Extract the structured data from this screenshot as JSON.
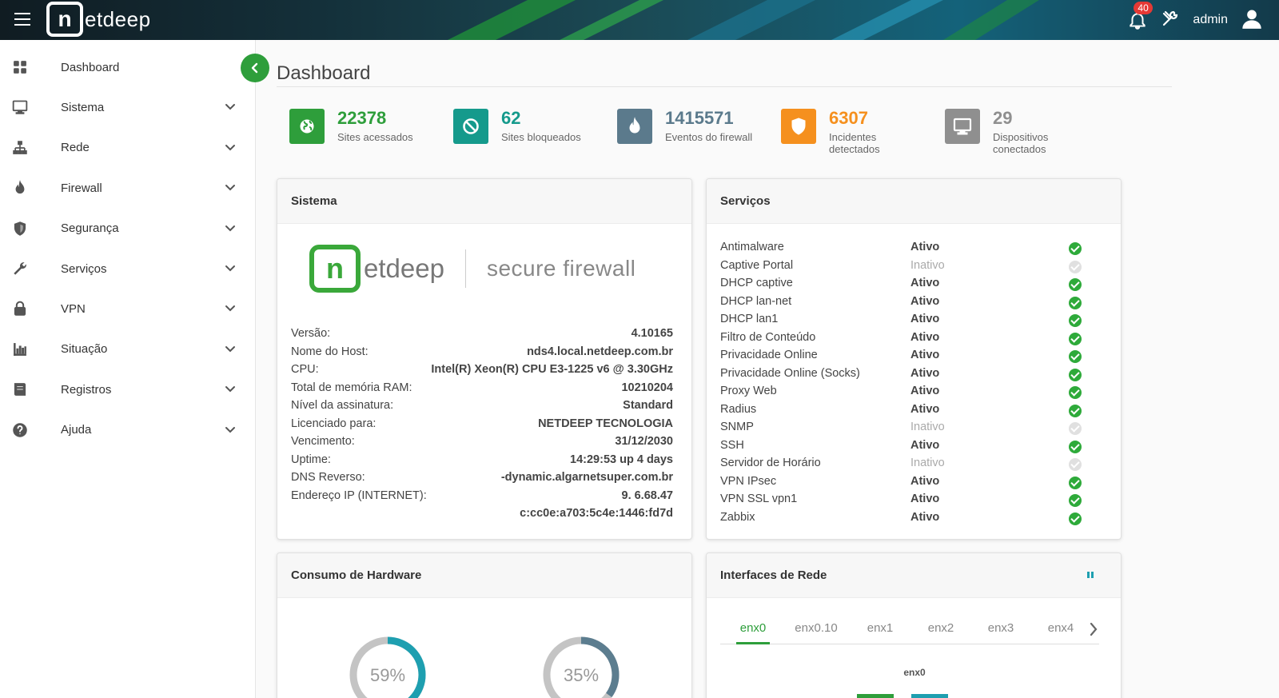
{
  "topbar": {
    "brand_n": "n",
    "brand_rest": "etdeep",
    "notifications": "40",
    "user": "admin"
  },
  "sidebar": {
    "items": [
      {
        "label": "Dashboard",
        "icon": "dashboard-icon",
        "expandable": false
      },
      {
        "label": "Sistema",
        "icon": "monitor-icon",
        "expandable": true
      },
      {
        "label": "Rede",
        "icon": "network-icon",
        "expandable": true
      },
      {
        "label": "Firewall",
        "icon": "fire-icon",
        "expandable": true
      },
      {
        "label": "Segurança",
        "icon": "shield-icon",
        "expandable": true
      },
      {
        "label": "Serviços",
        "icon": "wrench-icon",
        "expandable": true
      },
      {
        "label": "VPN",
        "icon": "lock-icon",
        "expandable": true
      },
      {
        "label": "Situação",
        "icon": "bar-chart-icon",
        "expandable": true
      },
      {
        "label": "Registros",
        "icon": "book-icon",
        "expandable": true
      },
      {
        "label": "Ajuda",
        "icon": "help-icon",
        "expandable": true
      }
    ]
  },
  "page": {
    "title": "Dashboard"
  },
  "stats": [
    {
      "value": "22378",
      "label": "Sites acessados",
      "color": "#2e9e3b",
      "icon": "globe-icon"
    },
    {
      "value": "62",
      "label": "Sites bloqueados",
      "color": "#159a8c",
      "icon": "block-icon"
    },
    {
      "value": "1415571",
      "label": "Eventos do firewall",
      "color": "#5b7a8c",
      "icon": "fire-icon"
    },
    {
      "value": "6307",
      "label": "Incidentes detectados",
      "color": "#f5901e",
      "icon": "shield-icon"
    },
    {
      "value": "29",
      "label": "Dispositivos conectados",
      "color": "#8f8f8f",
      "icon": "monitor-icon"
    }
  ],
  "sistema": {
    "title": "Sistema",
    "logo_n": "n",
    "logo_rest": "etdeep",
    "tagline": "secure firewall",
    "rows": [
      {
        "k": "Versão:",
        "v": "4.10165"
      },
      {
        "k": "Nome do Host:",
        "v": "nds4.local.netdeep.com.br"
      },
      {
        "k": "CPU:",
        "v": "Intel(R) Xeon(R) CPU E3-1225 v6 @ 3.30GHz"
      },
      {
        "k": "Total de memória RAM:",
        "v": "10210204"
      },
      {
        "k": "Nível da assinatura:",
        "v": "Standard"
      },
      {
        "k": "Licenciado para:",
        "v": "NETDEEP TECNOLOGIA"
      },
      {
        "k": "Vencimento:",
        "v": "31/12/2030"
      },
      {
        "k": "Uptime:",
        "v": "14:29:53 up 4 days"
      },
      {
        "k": "DNS Reverso:",
        "v": "-dynamic.algarnetsuper.com.br"
      },
      {
        "k": "Endereço IP (INTERNET):",
        "v": "9.    6.68.47"
      },
      {
        "k": "",
        "v": "c:cc0e:a703:5c4e:1446:fd7d"
      }
    ]
  },
  "servicos": {
    "title": "Serviços",
    "rows": [
      {
        "name": "Antimalware",
        "status": "Ativo",
        "active": true
      },
      {
        "name": "Captive Portal",
        "status": "Inativo",
        "active": false
      },
      {
        "name": "DHCP captive",
        "status": "Ativo",
        "active": true
      },
      {
        "name": "DHCP lan-net",
        "status": "Ativo",
        "active": true
      },
      {
        "name": "DHCP lan1",
        "status": "Ativo",
        "active": true
      },
      {
        "name": "Filtro de Conteúdo",
        "status": "Ativo",
        "active": true
      },
      {
        "name": "Privacidade Online",
        "status": "Ativo",
        "active": true
      },
      {
        "name": "Privacidade Online (Socks)",
        "status": "Ativo",
        "active": true
      },
      {
        "name": "Proxy Web",
        "status": "Ativo",
        "active": true
      },
      {
        "name": "Radius",
        "status": "Ativo",
        "active": true
      },
      {
        "name": "SNMP",
        "status": "Inativo",
        "active": false
      },
      {
        "name": "SSH",
        "status": "Ativo",
        "active": true
      },
      {
        "name": "Servidor de Horário",
        "status": "Inativo",
        "active": false
      },
      {
        "name": "VPN IPsec",
        "status": "Ativo",
        "active": true
      },
      {
        "name": "VPN SSL vpn1",
        "status": "Ativo",
        "active": true
      },
      {
        "name": "Zabbix",
        "status": "Ativo",
        "active": true
      }
    ]
  },
  "hardware": {
    "title": "Consumo de Hardware",
    "gauges": [
      {
        "value": 59,
        "label": "59%",
        "color": "#1e9fb0"
      },
      {
        "value": 35,
        "label": "35%",
        "color": "#5c7d8f"
      }
    ]
  },
  "interfaces": {
    "title": "Interfaces de Rede",
    "tabs": [
      "enx0",
      "enx0.10",
      "enx1",
      "enx2",
      "enx3",
      "enx4"
    ],
    "active_tab": "enx0",
    "chart_title": "enx0"
  },
  "colors": {
    "accent": "#2e9e3b",
    "teal": "#1e9fb0",
    "topbar": "#162a33"
  }
}
